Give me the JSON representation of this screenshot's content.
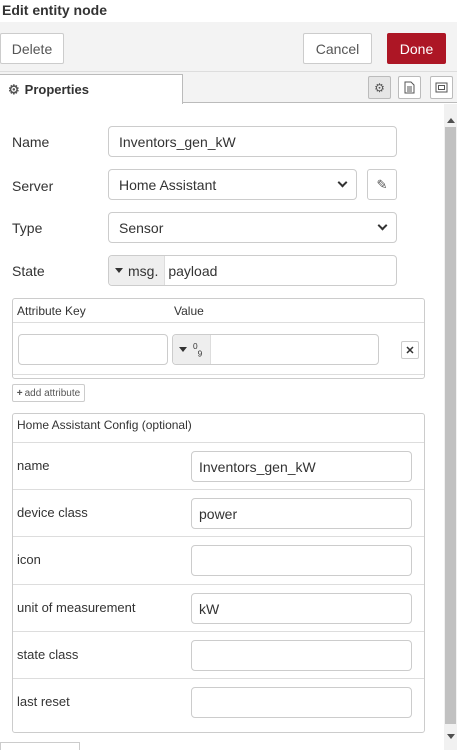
{
  "window": {
    "title": "Edit entity node"
  },
  "toolbar": {
    "delete_label": "Delete",
    "cancel_label": "Cancel",
    "done_label": "Done"
  },
  "tabs": {
    "properties_label": "Properties",
    "icons": [
      "gear-icon",
      "document-icon",
      "frame-icon"
    ]
  },
  "form": {
    "name_label": "Name",
    "name_value": "Inventors_gen_kW",
    "server_label": "Server",
    "server_value": "Home Assistant",
    "type_label": "Type",
    "type_value": "Sensor",
    "state_label": "State",
    "state_type": "msg.",
    "state_value": "payload"
  },
  "attributes": {
    "key_header": "Attribute Key",
    "value_header": "Value",
    "rows": [
      {
        "key": "",
        "type": "0 9",
        "value": ""
      }
    ],
    "add_label": "add attribute"
  },
  "ha_config": {
    "header": "Home Assistant Config (optional)",
    "rows": [
      {
        "label": "name",
        "value": "Inventors_gen_kW"
      },
      {
        "label": "device class",
        "value": "power"
      },
      {
        "label": "icon",
        "value": ""
      },
      {
        "label": "unit of measurement",
        "value": "kW"
      },
      {
        "label": "state class",
        "value": ""
      },
      {
        "label": "last reset",
        "value": ""
      }
    ]
  },
  "colors": {
    "done_button": "#ad1625",
    "toolbar_bg": "#f3f3f3"
  }
}
